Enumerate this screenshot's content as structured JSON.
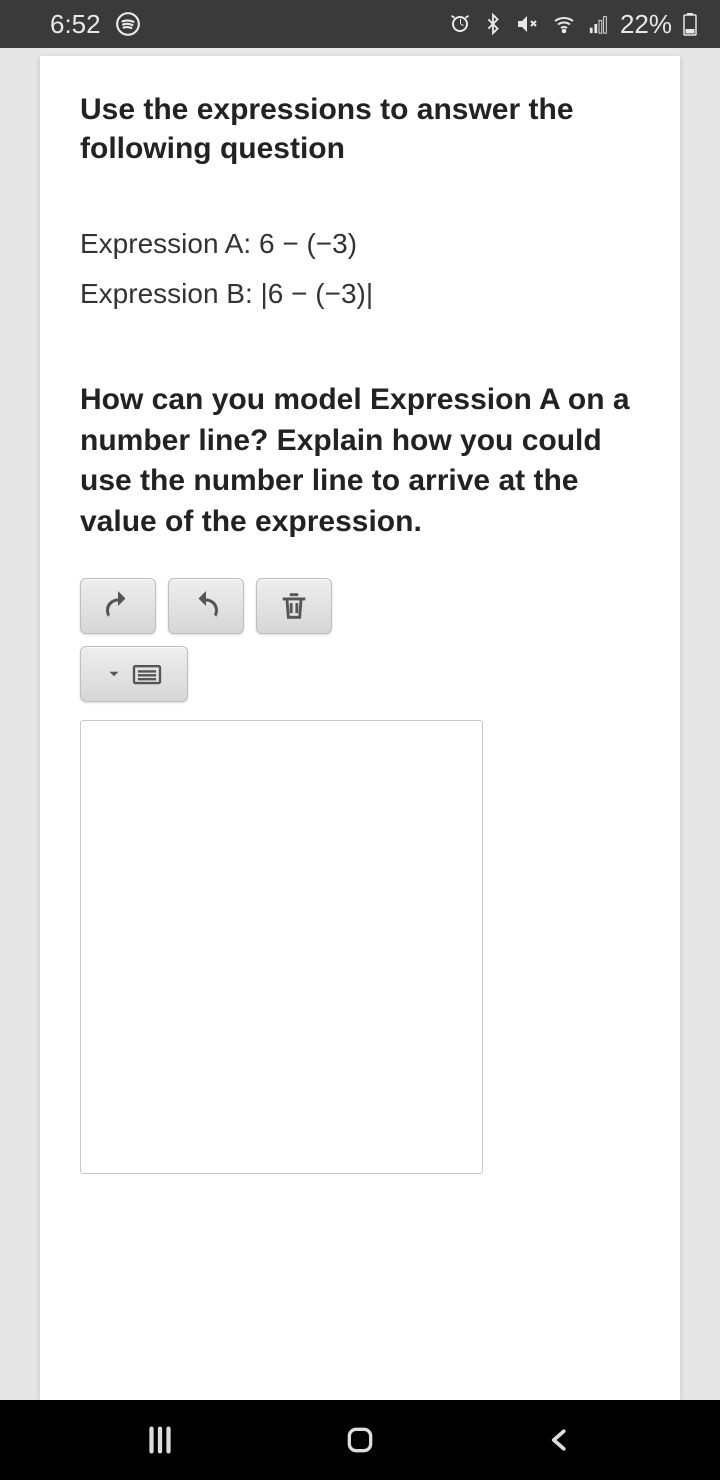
{
  "status": {
    "time": "6:52",
    "battery": "22%"
  },
  "content": {
    "heading": "Use the expressions to answer the following question",
    "expressionA": "Expression A: 6 − (−3)",
    "expressionB": "Expression B: |6 − (−3)|",
    "question": "How can you model Expression A on a number line? Explain how you could use the number line to arrive at the value of the expression.",
    "answer_value": ""
  },
  "icons": {
    "undo": "undo",
    "redo": "redo",
    "delete": "delete",
    "editor_menu": "editor-menu"
  }
}
